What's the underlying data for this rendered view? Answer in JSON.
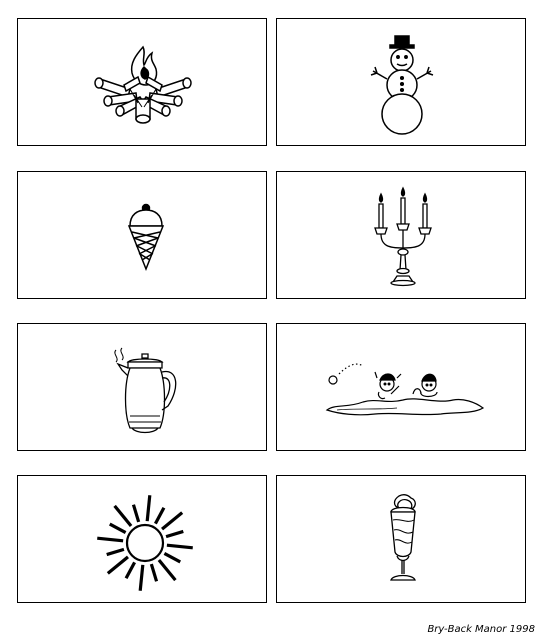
{
  "cards": [
    {
      "icon": "campfire-icon"
    },
    {
      "icon": "snowman-icon"
    },
    {
      "icon": "ice-cream-cone-icon"
    },
    {
      "icon": "candelabra-icon"
    },
    {
      "icon": "coffee-percolator-icon"
    },
    {
      "icon": "snowball-fight-icon"
    },
    {
      "icon": "sun-icon"
    },
    {
      "icon": "ice-cream-sundae-icon"
    }
  ],
  "footer": {
    "credit": "Bry-Back Manor 1998"
  }
}
